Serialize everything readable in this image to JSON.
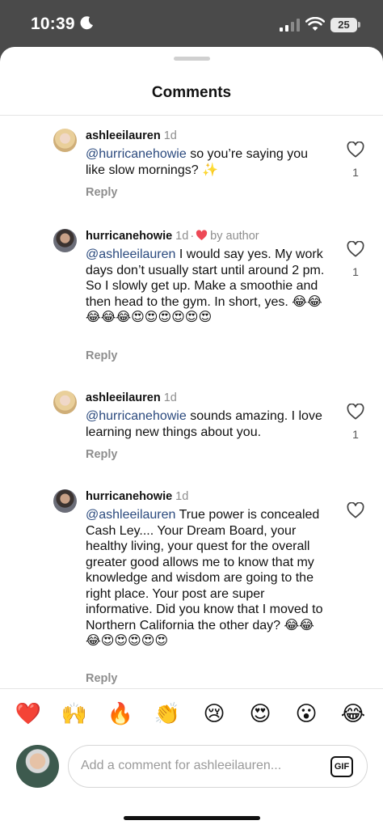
{
  "status": {
    "time": "10:39",
    "battery": "25"
  },
  "sheet": {
    "title": "Comments"
  },
  "comments": [
    {
      "user": "ashleeilauren",
      "time": "1d",
      "mention": "@hurricanehowie",
      "text": " so you’re saying you like slow mornings? ✨",
      "reply_label": "Reply",
      "likes": "1"
    },
    {
      "user": "hurricanehowie",
      "time": "1d",
      "badge": "by author",
      "mention": "@ashleeilauren",
      "text": " I would say yes. My work days don’t usually start until around 2 pm. So I slowly get up. Make a smoothie and then head to the gym. In short, yes. 😂😂😂😂😂😍😍😍😍😍😍",
      "reply_label": "Reply",
      "likes": "1"
    },
    {
      "user": "ashleeilauren",
      "time": "1d",
      "mention": "@hurricanehowie",
      "text": " sounds amazing. I love learning new things about you.",
      "reply_label": "Reply",
      "likes": "1"
    },
    {
      "user": "hurricanehowie",
      "time": "1d",
      "mention": "@ashleeilauren",
      "text": " True power is concealed Cash Ley.... Your Dream Board, your healthy living, your quest for the overall greater good allows me to know that my knowledge and wisdom are going to the right place. Your post are super informative. Did you know that I  moved to Northern California the other day? 😂😂😂😍😍😍😍😍",
      "reply_label": "Reply",
      "likes": ""
    }
  ],
  "reactions": [
    "❤️",
    "🙌",
    "🔥",
    "👏",
    "😢",
    "😍",
    "😮",
    "😂"
  ],
  "composer": {
    "placeholder": "Add a comment for ashleeilauren...",
    "gif_label": "GIF"
  },
  "colors": {
    "mention": "#2b4a7e",
    "muted": "#8e8e8e",
    "heart_red": "#ed4956"
  }
}
